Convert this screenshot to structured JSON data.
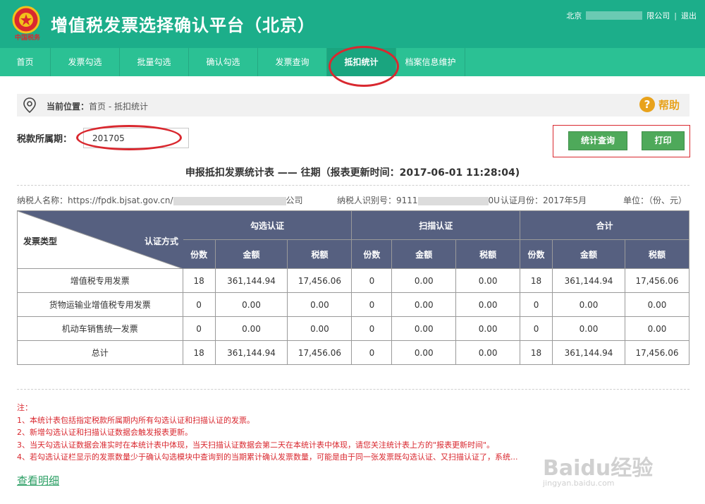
{
  "header": {
    "title": "增值税发票选择确认平台（北京）",
    "emblem": "national-tax-emblem",
    "emblem_text": "中国税务",
    "user_prefix": "北京",
    "user_suffix": "限公司",
    "separator": "|",
    "logout_label": "退出"
  },
  "nav": {
    "items": [
      {
        "label": "首页"
      },
      {
        "label": "发票勾选"
      },
      {
        "label": "批量勾选"
      },
      {
        "label": "确认勾选"
      },
      {
        "label": "发票查询"
      },
      {
        "label": "抵扣统计",
        "active": true
      },
      {
        "label": "档案信息维护"
      }
    ]
  },
  "breadcrumb": {
    "label": "当前位置：",
    "path": "首页 - 抵扣统计",
    "icon": "location-pin-icon"
  },
  "help": {
    "label": "帮助",
    "icon_glyph": "?"
  },
  "period": {
    "label": "税款所属期：",
    "value": "201705"
  },
  "actions": {
    "query_label": "统计查询",
    "print_label": "打印"
  },
  "report": {
    "title": "申报抵扣发票统计表 —— 往期（报表更新时间：2017-06-01 11:28:04)"
  },
  "meta": {
    "taxpayer_name_label": "纳税人名称：https://fpdk.bjsat.gov.cn/",
    "taxpayer_name_suffix": "公司",
    "taxpayer_id_label": "纳税人识别号：9111",
    "taxpayer_id_suffix": "0U",
    "cert_month": "认证月份：2017年5月",
    "unit": "单位：（份、元）"
  },
  "table": {
    "corner_row_label": "发票类型",
    "corner_col_label": "认证方式",
    "groups": [
      "勾选认证",
      "扫描认证",
      "合计"
    ],
    "sub_headers": [
      "份数",
      "金额",
      "税额"
    ],
    "rows": [
      {
        "type": "增值税专用发票",
        "cells": [
          "18",
          "361,144.94",
          "17,456.06",
          "0",
          "0.00",
          "0.00",
          "18",
          "361,144.94",
          "17,456.06"
        ]
      },
      {
        "type": "货物运输业增值税专用发票",
        "cells": [
          "0",
          "0.00",
          "0.00",
          "0",
          "0.00",
          "0.00",
          "0",
          "0.00",
          "0.00"
        ]
      },
      {
        "type": "机动车销售统一发票",
        "cells": [
          "0",
          "0.00",
          "0.00",
          "0",
          "0.00",
          "0.00",
          "0",
          "0.00",
          "0.00"
        ]
      },
      {
        "type": "总计",
        "cells": [
          "18",
          "361,144.94",
          "17,456.06",
          "0",
          "0.00",
          "0.00",
          "18",
          "361,144.94",
          "17,456.06"
        ]
      }
    ]
  },
  "notes": {
    "title": "注：",
    "items": [
      "1、本统计表包括指定税款所属期内所有勾选认证和扫描认证的发票。",
      "2、新增勾选认证和扫描认证数据会触发报表更新。",
      "3、当天勾选认证数据会准实时在本统计表中体现，当天扫描认证数据会第二天在本统计表中体现，请您关注统计表上方的\"报表更新时间\"。",
      "4、若勾选认证栏显示的发票数量少于确认勾选模块中查询到的当期累计确认发票数量，可能是由于同一张发票既勾选认证、又扫描认证了，系统..."
    ]
  },
  "detail_link": "查看明细",
  "watermark": {
    "main": "Baidu经验",
    "sub": "jingyan.baidu.com"
  },
  "colors": {
    "header_bg": "#1cae8a",
    "nav_bg": "#2bc194",
    "table_header_bg": "#566080",
    "highlight_red": "#d9282f",
    "button_green": "#4ea95a",
    "help_orange": "#e8a21b"
  }
}
